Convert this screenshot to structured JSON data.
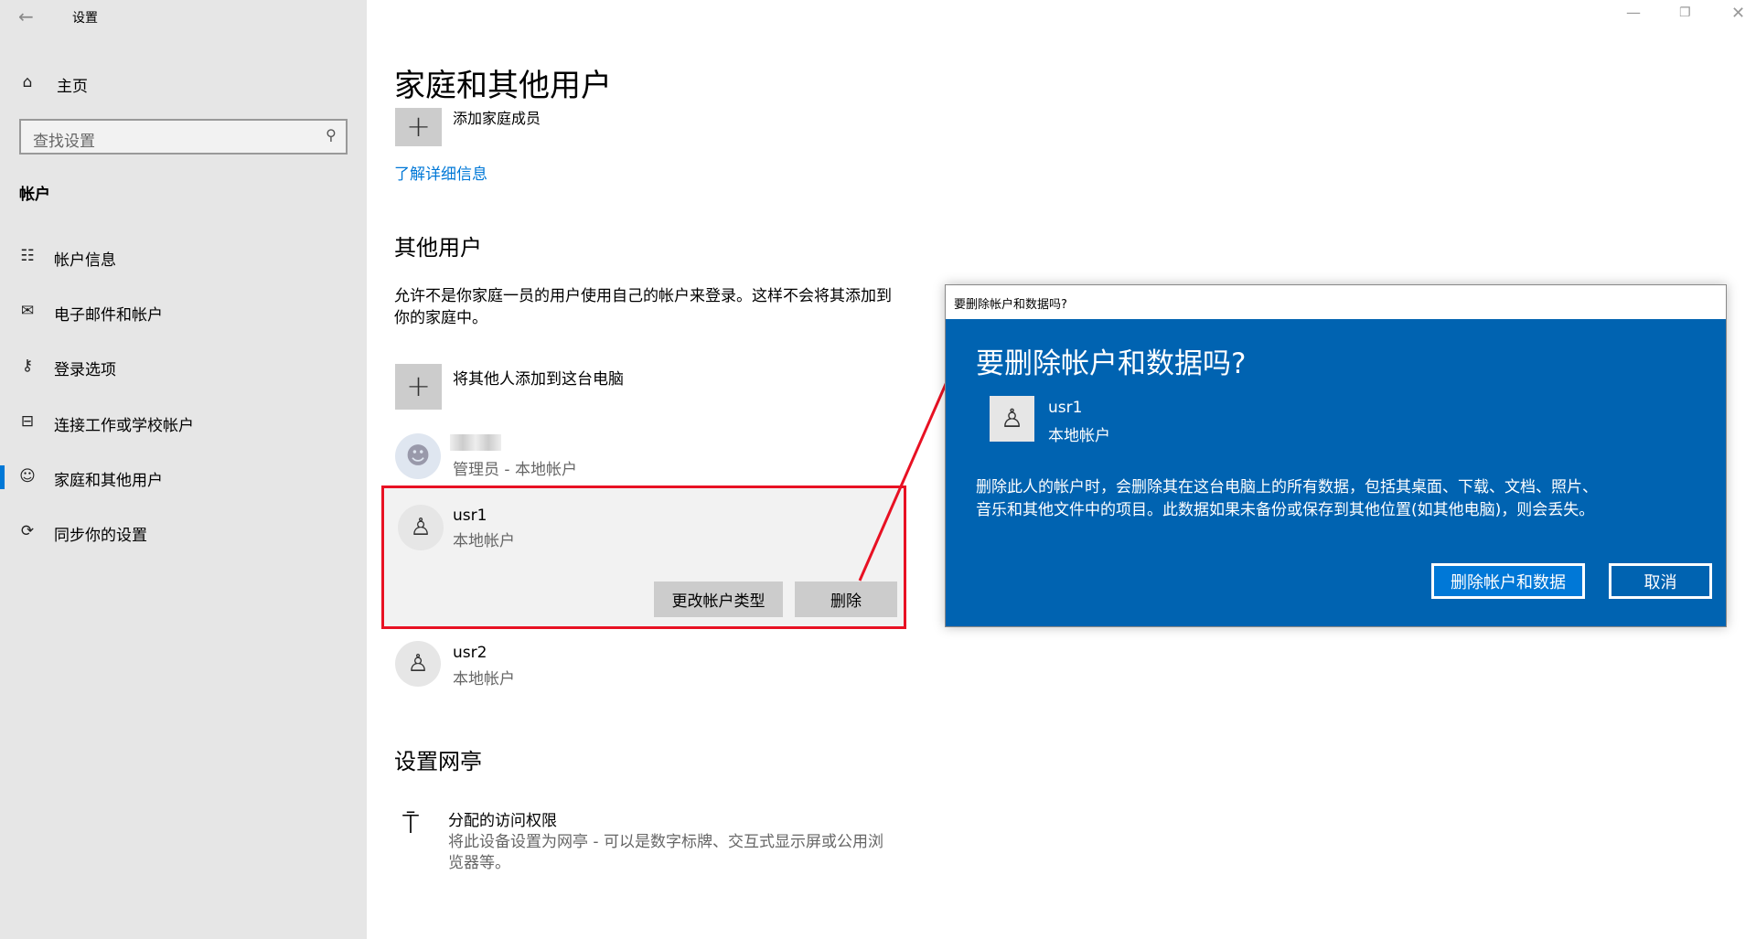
{
  "window": {
    "title": "设置"
  },
  "sidebar": {
    "home": "主页",
    "search_placeholder": "查找设置",
    "section": "帐户",
    "items": [
      {
        "label": "帐户信息",
        "icon": "account-info-icon"
      },
      {
        "label": "电子邮件和帐户",
        "icon": "mail-icon"
      },
      {
        "label": "登录选项",
        "icon": "key-icon"
      },
      {
        "label": "连接工作或学校帐户",
        "icon": "briefcase-icon"
      },
      {
        "label": "家庭和其他用户",
        "icon": "person-icon",
        "selected": true
      },
      {
        "label": "同步你的设置",
        "icon": "sync-icon"
      }
    ]
  },
  "main": {
    "title": "家庭和其他用户",
    "add_family": "添加家庭成员",
    "learn_more": "了解详细信息",
    "other_users_heading": "其他用户",
    "other_users_desc_1": "允许不是你家庭一员的用户使用自己的帐户来登录。这样不会将其添加到",
    "other_users_desc_2": "你的家庭中。",
    "add_other": "将其他人添加到这台电脑",
    "admin": {
      "role": "管理员 - 本地帐户"
    },
    "usr1": {
      "name": "usr1",
      "type": "本地帐户",
      "change_type": "更改帐户类型",
      "delete": "删除"
    },
    "usr2": {
      "name": "usr2",
      "type": "本地帐户"
    },
    "kiosk_heading": "设置网亭",
    "kiosk_title": "分配的访问权限",
    "kiosk_desc_1": "将此设备设置为网亭 - 可以是数字标牌、交互式显示屏或公用浏",
    "kiosk_desc_2": "览器等。"
  },
  "dialog": {
    "titlebar": "要删除帐户和数据吗?",
    "heading": "要删除帐户和数据吗?",
    "user": "usr1",
    "user_type": "本地帐户",
    "message_1": "删除此人的帐户时，会删除其在这台电脑上的所有数据，包括其桌面、下载、文档、照片、",
    "message_2": "音乐和其他文件中的项目。此数据如果未备份或保存到其他位置(如其他电脑)，则会丢失。",
    "confirm": "删除帐户和数据",
    "cancel": "取消"
  },
  "colors": {
    "accent": "#0067b8",
    "dialog_bg": "#0063b1",
    "link": "#0078d7",
    "highlight": "#e81123"
  }
}
